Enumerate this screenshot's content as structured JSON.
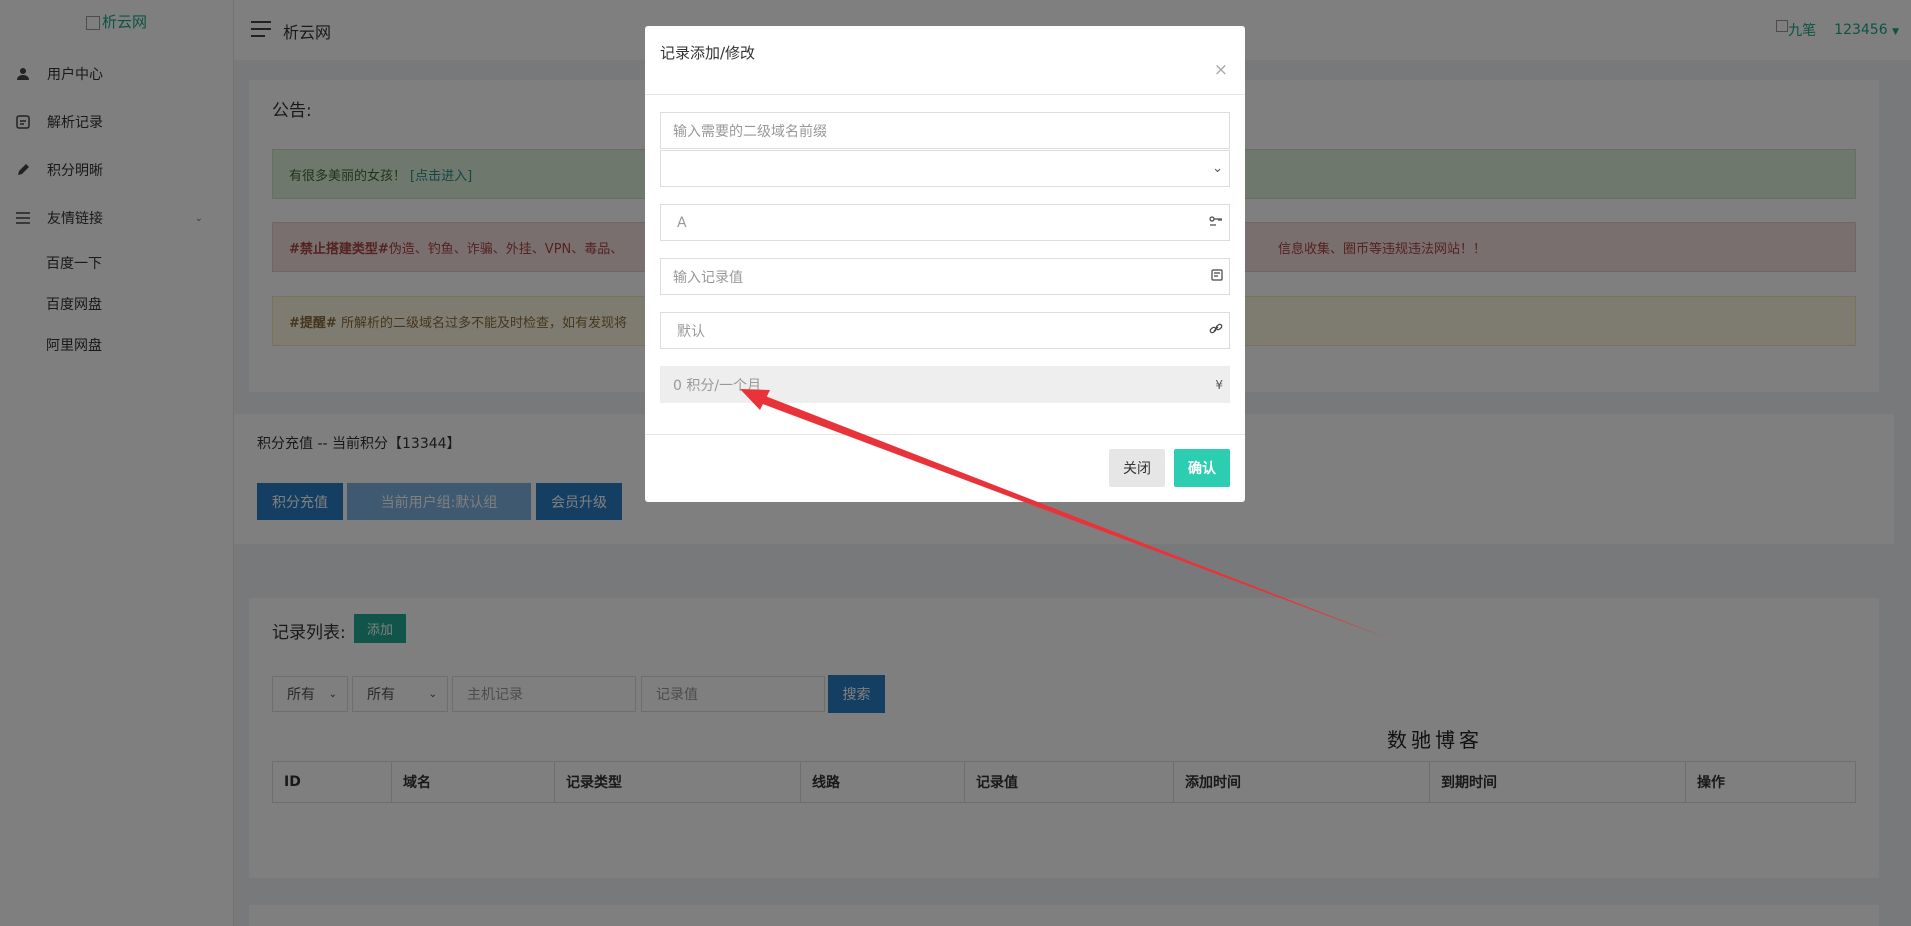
{
  "sidebar": {
    "logo_alt": "析云网",
    "items": [
      {
        "label": "用户中心",
        "icon": "user-icon"
      },
      {
        "label": "解析记录",
        "icon": "record-icon"
      },
      {
        "label": "积分明晰",
        "icon": "pen-icon"
      },
      {
        "label": "友情链接",
        "icon": "list-icon"
      }
    ],
    "sub_items": [
      "百度一下",
      "百度网盘",
      "阿里网盘"
    ]
  },
  "header": {
    "title": "析云网",
    "user_name": "九笔",
    "user_id": "123456"
  },
  "notice": {
    "title": "公告:",
    "green_text": "有很多美丽的女孩！",
    "green_link": "[点击进入]",
    "red_tag": "#禁止搭建类型#",
    "red_text": "伪造、钓鱼、诈骗、外挂、VPN、毒品、",
    "red_text_tail": "信息收集、圈币等违规违法网站！！",
    "yellow_tag": "#提醒#",
    "yellow_text": "所解析的二级域名过多不能及时检查，如有发现将"
  },
  "points": {
    "line": "积分充值 -- 当前积分【13344】",
    "recharge_btn": "积分充值",
    "group_btn": "当前用户组:默认组",
    "upgrade_btn": "会员升级"
  },
  "records": {
    "title": "记录列表:",
    "add_btn": "添加",
    "filter1": "所有",
    "filter2": "所有",
    "host_placeholder": "主机记录",
    "value_placeholder": "记录值",
    "search_btn": "搜索",
    "columns": [
      "ID",
      "域名",
      "记录类型",
      "线路",
      "记录值",
      "添加时间",
      "到期时间",
      "操作"
    ]
  },
  "watermark": "数驰博客",
  "modal": {
    "title": "记录添加/修改",
    "close_x": "×",
    "prefix_placeholder": "输入需要的二级域名前缀",
    "type_value": "A",
    "record_value_placeholder": "输入记录值",
    "line_value": "默认",
    "cost_value": "0 积分/一个月",
    "currency_symbol": "¥",
    "cancel_btn": "关闭",
    "confirm_btn": "确认"
  },
  "colors": {
    "accent": "#1aa689",
    "primary_btn": "#2b7fc5",
    "confirm": "#2dcdb2",
    "arrow": "#e8333a"
  }
}
